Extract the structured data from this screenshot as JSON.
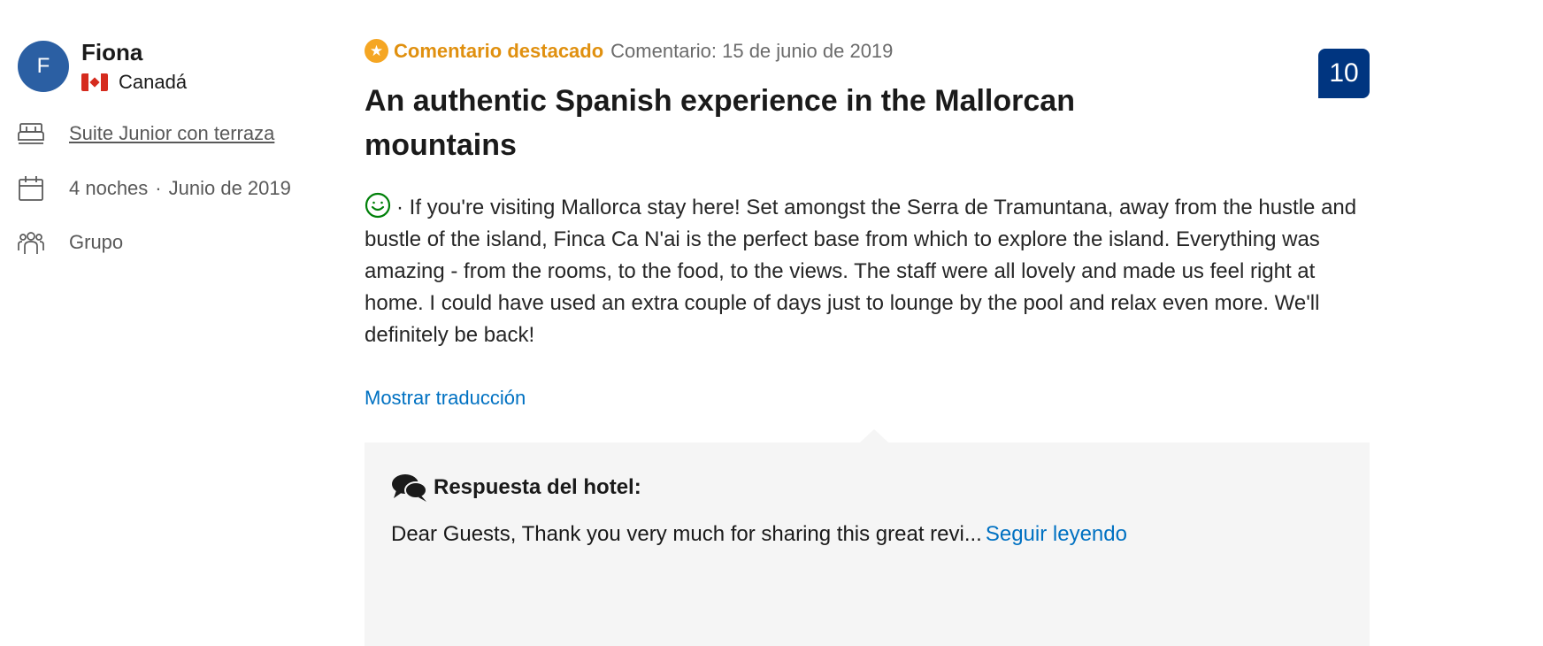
{
  "reviewer": {
    "initial": "F",
    "name": "Fiona",
    "country": "Canadá",
    "avatar_color": "#2b5fa3"
  },
  "stay": {
    "room": "Suite Junior con terraza",
    "nights": "4 noches",
    "separator": "·",
    "month": "Junio de 2019",
    "traveler_type": "Grupo",
    "icons": [
      "bed-icon",
      "calendar-icon",
      "group-icon"
    ]
  },
  "review": {
    "featured_label": "Comentario destacado",
    "date": "Comentario: 15 de junio de 2019",
    "title": "An authentic Spanish experience in the Mallorcan mountains",
    "body": "· If you're visiting Mallorca stay here! Set amongst the Serra de Tramuntana, away from the hustle and bustle of the island, Finca Ca N'ai is the perfect base from which to explore the island. Everything was amazing - from the rooms, to the food, to the views. The staff were all lovely and made us feel right at home. I could have used an extra couple of days just to lounge by the pool and relax even more. We'll definitely be back!",
    "show_translation": "Mostrar traducción",
    "score": "10",
    "score_color": "#003580",
    "accent_color": "#e0900f",
    "sentiment_icon": "smile-icon"
  },
  "hotel_response": {
    "header": "Respuesta del hotel:",
    "text": "Dear Guests, Thank you very much for sharing this great revi...",
    "read_more": "Seguir leyendo",
    "icon": "speech-bubbles-icon"
  },
  "colors": {
    "link": "#0071c2",
    "response_background": "#f5f5f5"
  }
}
